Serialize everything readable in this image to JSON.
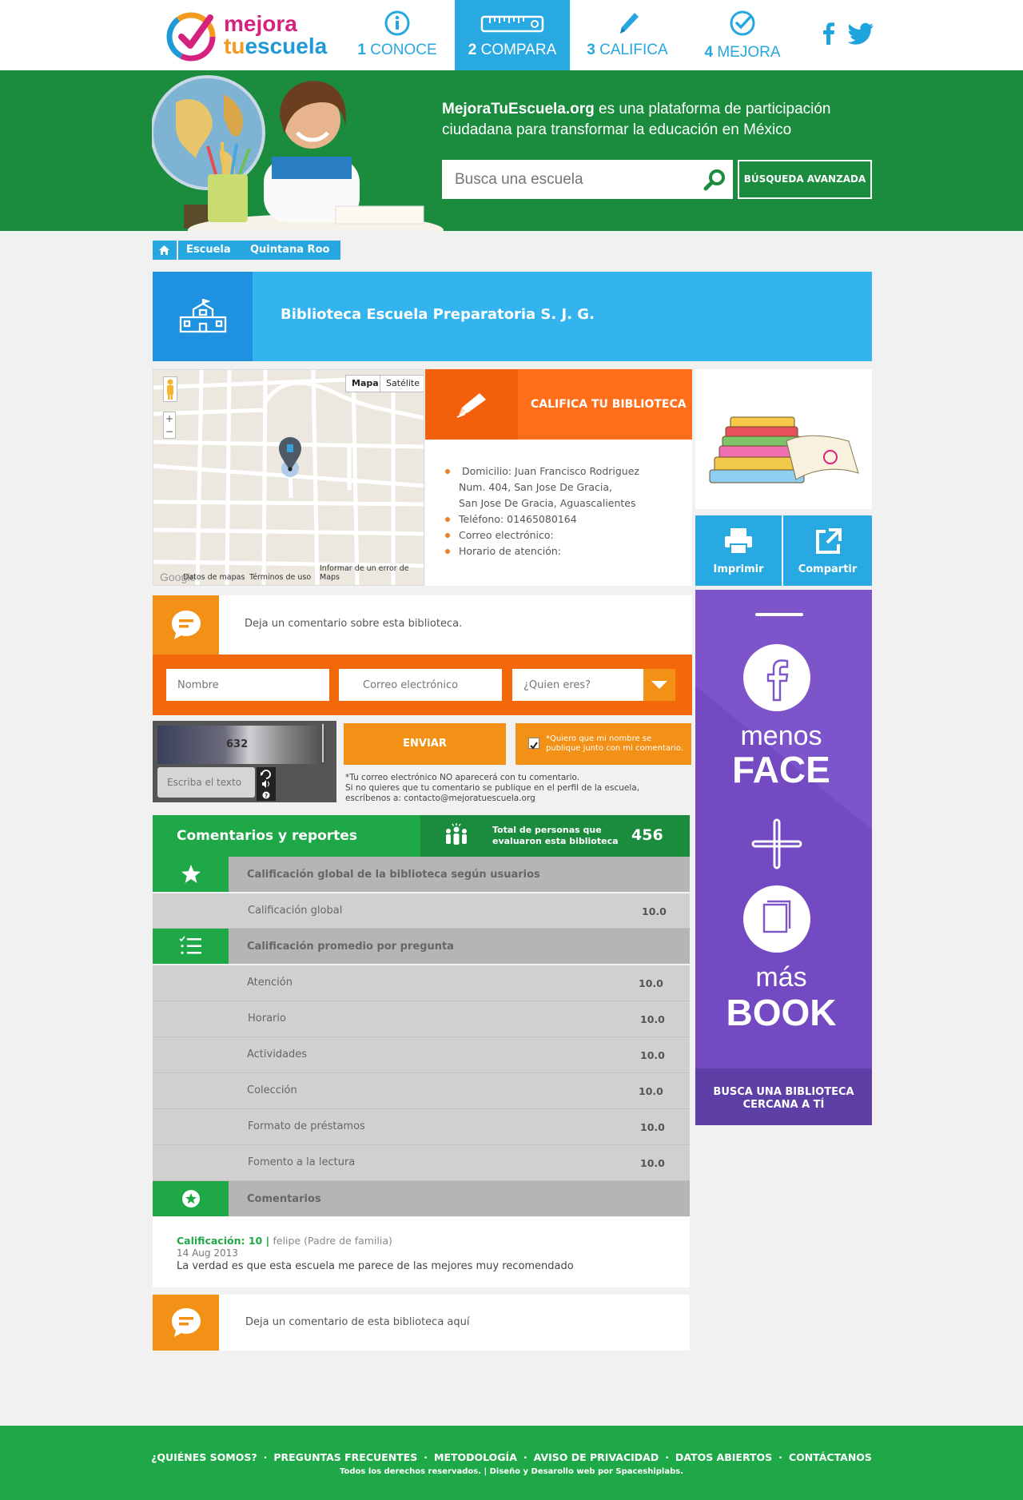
{
  "logo": {
    "line1": "mejora",
    "line2_a": "tu",
    "line2_b": "escuela"
  },
  "nav": [
    {
      "num": "1",
      "label": "CONOCE",
      "icon": "info-icon"
    },
    {
      "num": "2",
      "label": "COMPARA",
      "icon": "ruler-icon",
      "active": true
    },
    {
      "num": "3",
      "label": "CALIFICA",
      "icon": "pencil-icon"
    },
    {
      "num": "4",
      "label": "MEJORA",
      "icon": "check-circle-icon"
    }
  ],
  "hero": {
    "brand": "MejoraTuEscuela.org",
    "tagline": " es una plataforma de participación ciudadana para transformar la educación en México",
    "search_placeholder": "Busca una escuela",
    "advanced": "BÚSQUEDA AVANZADA"
  },
  "breadcrumb": [
    "Escuela",
    "Quintana Roo"
  ],
  "title": "Biblioteca Escuela Preparatoria S. J. G.",
  "map": {
    "btn_map": "Mapa",
    "btn_sat": "Satélite",
    "footer": [
      "Datos de mapas",
      "Términos de uso",
      "Informar de un error de Maps"
    ]
  },
  "califica": "CALIFICA TU BIBLIOTECA",
  "info": {
    "domicilio": "Domicilio: Juan Francisco Rodriguez",
    "dom2": "Num. 404, San Jose De Gracia,",
    "dom3": "San Jose De Gracia, Aguascalientes",
    "telefono": "Teléfono: 01465080164",
    "correo": "Correo electrónico:",
    "horario": "Horario de atención:"
  },
  "actions": {
    "print": "Imprimir",
    "share": "Compartir"
  },
  "comment_form": {
    "prompt": "Deja un comentario sobre esta biblioteca.",
    "name_ph": "Nombre",
    "email_ph": "Correo electrónico",
    "who_ph": "¿Quien eres?",
    "captcha_text": "632",
    "captcha_ph": "Escriba el texto",
    "send": "ENVIAR",
    "publish": "*Quiero que mi nombre se publique junto con mi comentario.",
    "note1": "*Tu correo electrónico NO aparecerá con tu comentario.",
    "note2": "Si no quieres que tu comentario se publique en el perfil de la escuela,",
    "note3": "escríbenos a: contacto@mejoratuescuela.org"
  },
  "reports": {
    "title": "Comentarios y reportes",
    "total_label1": "Total de personas que",
    "total_label2": "evaluaron esta biblioteca",
    "total": "456",
    "global_head": "Calificación global de la biblioteca según usuarios",
    "global_label": "Calificación global",
    "global_value": "10.0",
    "avg_head": "Calificación promedio por pregunta",
    "questions": [
      {
        "label": "Atención",
        "value": "10.0"
      },
      {
        "label": "Horario",
        "value": "10.0"
      },
      {
        "label": "Actividades",
        "value": "10.0"
      },
      {
        "label": "Colección",
        "value": "10.0"
      },
      {
        "label": "Formato de préstamos",
        "value": "10.0"
      },
      {
        "label": "Fomento a la lectura",
        "value": "10.0"
      }
    ],
    "comments_head": "Comentarios"
  },
  "comment": {
    "rating": "Calificación: 10 | ",
    "author": "felipe (Padre de familia)",
    "date": "14 Aug 2013",
    "text": "La verdad es que esta escuela me parece de las mejores muy recomendado"
  },
  "comment_form2": "Deja un comentario de esta biblioteca aquí",
  "banner": {
    "l1": "menos",
    "l2": "FACE",
    "l3": "más",
    "l4": "BOOK",
    "cta": "BUSCA UNA BIBLIOTECA CERCANA A TÍ"
  },
  "footer": {
    "links": [
      "¿QUIÉNES SOMOS?",
      "PREGUNTAS FRECUENTES",
      "METODOLOGÍA",
      "AVISO DE PRIVACIDAD",
      "DATOS ABIERTOS",
      "CONTÁCTANOS"
    ],
    "copy": "Todos los derechos reservados. | Diseño y Desarollo web por Spaceshiplabs."
  },
  "colors": {
    "blue": "#29a9e1",
    "green": "#1ea847",
    "dark_green": "#1b8b3e",
    "orange": "#f4680c",
    "purple": "#7e54cb"
  }
}
